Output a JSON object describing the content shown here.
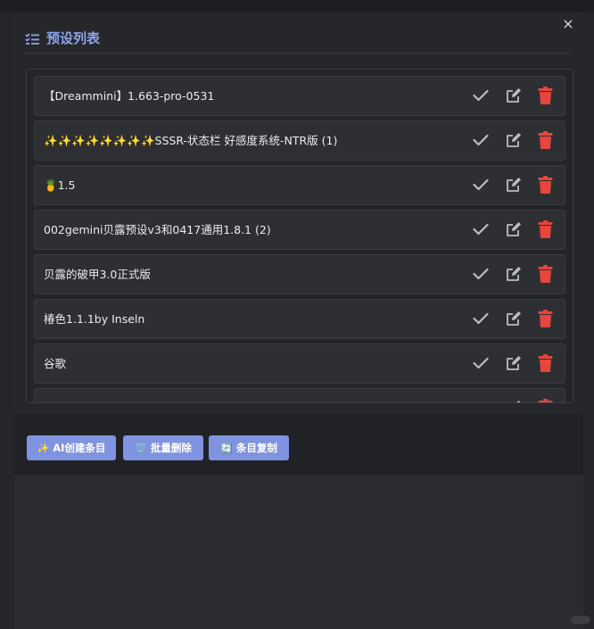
{
  "dialog": {
    "title": "预设列表",
    "close_label": "×"
  },
  "presets": [
    {
      "label": "【Dreammini】1.663-pro-0531"
    },
    {
      "label": "✨✨✨✨✨✨✨✨SSSR-状态栏 好感度系统-NTR版 (1)"
    },
    {
      "label": "🍍1.5"
    },
    {
      "label": "002gemini贝露预设v3和0417通用1.8.1 (2)"
    },
    {
      "label": "贝露的破甲3.0正式版"
    },
    {
      "label": "椿色1.1.1by Inseln"
    },
    {
      "label": "谷歌"
    },
    {
      "label": ""
    }
  ],
  "footer": {
    "ai_create_icon": "✨",
    "ai_create_label": "AI创建条目",
    "batch_delete_icon": "🗑️",
    "batch_delete_label": "批量删除",
    "copy_icon": "🔄",
    "copy_label": "条目复制"
  },
  "colors": {
    "accent": "#8ea4ea",
    "button_bg": "#7f93e0",
    "delete_red": "#e8453c",
    "icon_gray": "#bdbdbd"
  },
  "icons": {
    "apply": "check-icon",
    "edit": "edit-icon",
    "delete": "trash-icon",
    "title": "list-checks-icon",
    "close": "close-icon"
  }
}
